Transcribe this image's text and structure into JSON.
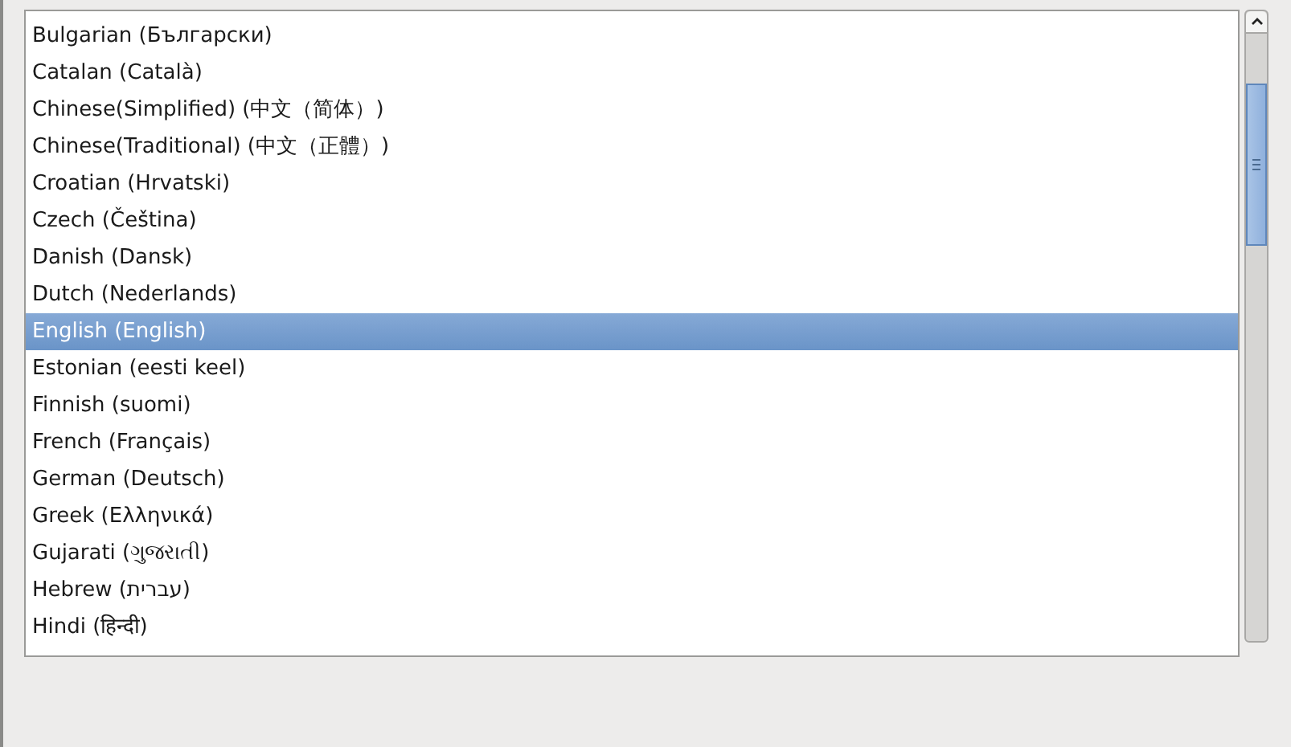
{
  "language_list": {
    "items": [
      {
        "label": "Bulgarian (Български)",
        "selected": false
      },
      {
        "label": "Catalan (Català)",
        "selected": false
      },
      {
        "label": "Chinese(Simplified) (中文（简体）)",
        "selected": false
      },
      {
        "label": "Chinese(Traditional) (中文（正體）)",
        "selected": false
      },
      {
        "label": "Croatian (Hrvatski)",
        "selected": false
      },
      {
        "label": "Czech (Čeština)",
        "selected": false
      },
      {
        "label": "Danish (Dansk)",
        "selected": false
      },
      {
        "label": "Dutch (Nederlands)",
        "selected": false
      },
      {
        "label": "English (English)",
        "selected": true
      },
      {
        "label": "Estonian (eesti keel)",
        "selected": false
      },
      {
        "label": "Finnish (suomi)",
        "selected": false
      },
      {
        "label": "French (Français)",
        "selected": false
      },
      {
        "label": "German (Deutsch)",
        "selected": false
      },
      {
        "label": "Greek (Ελληνικά)",
        "selected": false
      },
      {
        "label": "Gujarati (ગુજરાતી)",
        "selected": false
      },
      {
        "label": "Hebrew (עברית)",
        "selected": false
      },
      {
        "label": "Hindi (हिन्दी)",
        "selected": false
      }
    ]
  }
}
